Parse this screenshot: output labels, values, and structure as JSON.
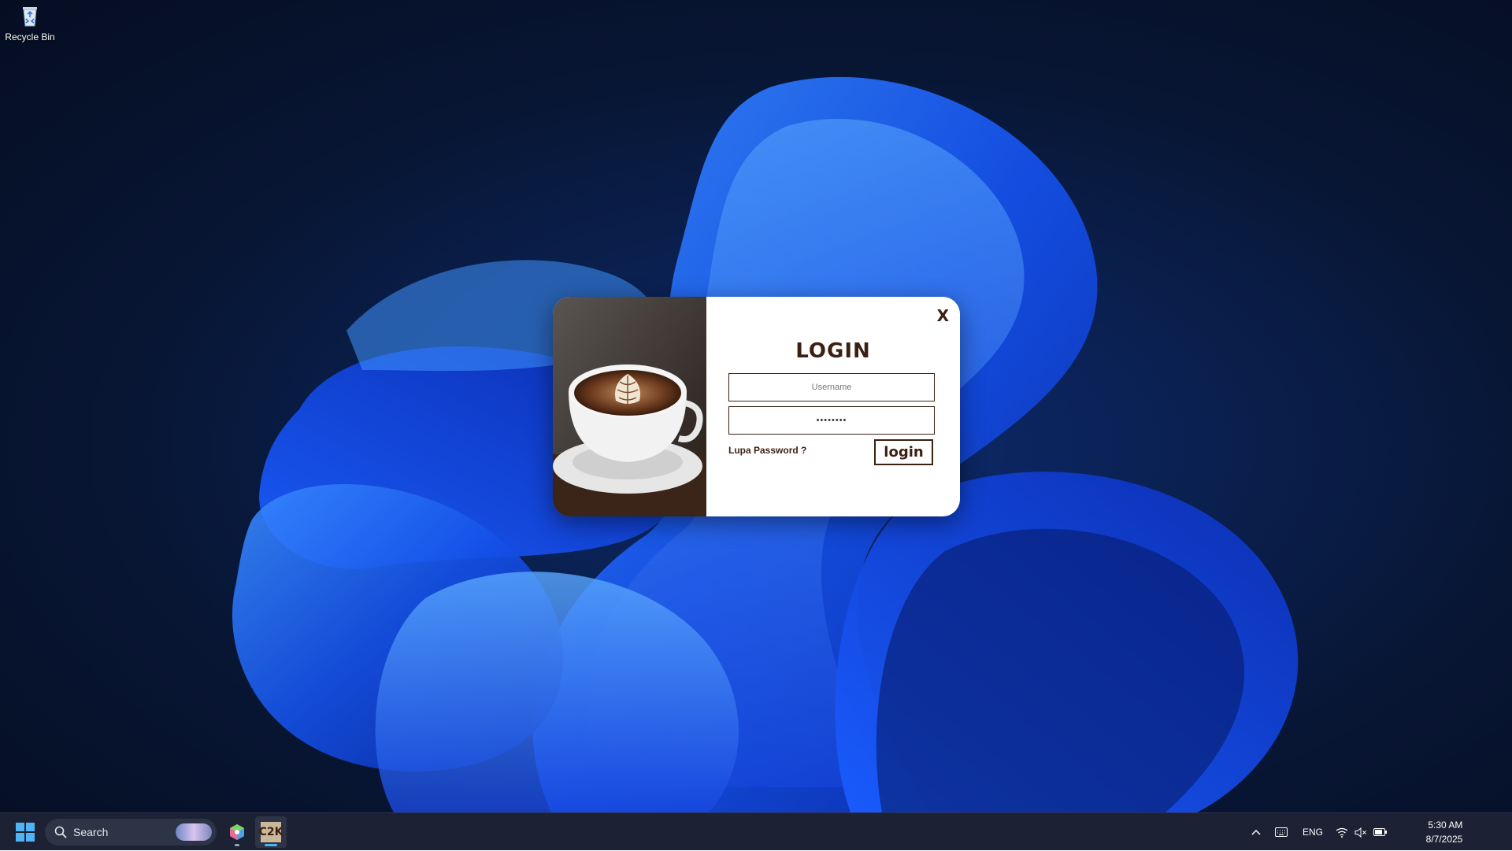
{
  "desktop": {
    "icons": [
      {
        "label": "Recycle Bin",
        "icon": "recycle-bin-icon"
      }
    ]
  },
  "login_window": {
    "close_label": "X",
    "title": "LOGIN",
    "username_placeholder": "Username",
    "password_value": "••••••••",
    "forgot_label": "Lupa Password ?",
    "login_button": "login",
    "brand_color": "#3b1f12"
  },
  "taskbar": {
    "search_placeholder": "Search",
    "apps": [
      {
        "icon": "windows-start-icon"
      },
      {
        "icon": "box-app-icon"
      },
      {
        "icon": "c2k-app-icon",
        "label": "C2K"
      }
    ],
    "tray": {
      "language": "ENG",
      "time": "5:30 AM",
      "date": "8/7/2025",
      "icons": [
        "chevron-up-icon",
        "keyboard-icon",
        "wifi-icon",
        "speaker-muted-icon",
        "battery-icon"
      ]
    }
  }
}
